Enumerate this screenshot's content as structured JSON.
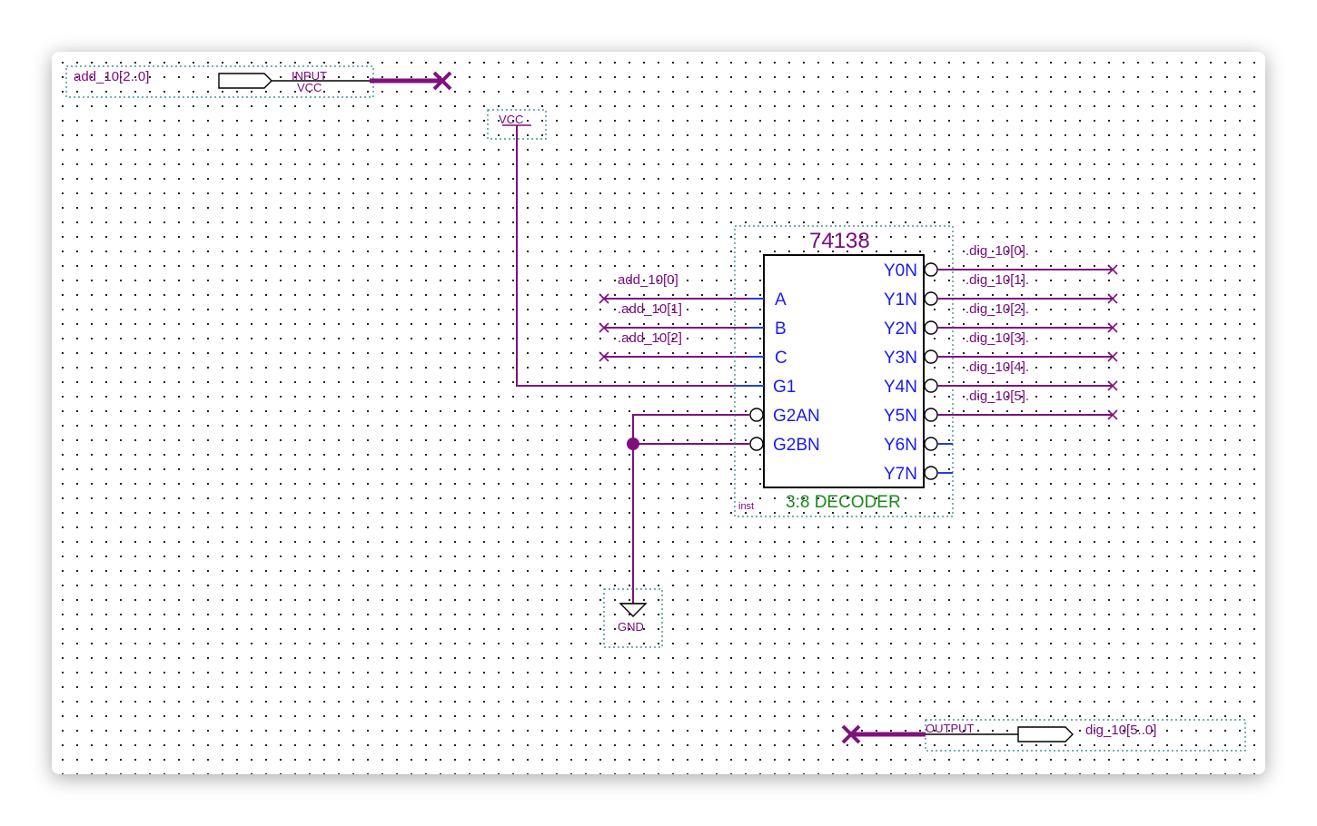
{
  "input_port": {
    "name": "add_10[2..0]",
    "type_label": "INPUT",
    "default_label": "VCC"
  },
  "output_port": {
    "name": "dig_10[5..0]",
    "type_label": "OUTPUT"
  },
  "vcc_symbol": {
    "label": "VCC"
  },
  "gnd_symbol": {
    "label": "GND"
  },
  "decoder": {
    "part_number": "74138",
    "description": "3:8 DECODER",
    "instance": "inst",
    "inputs": [
      "A",
      "B",
      "C",
      "G1",
      "G2AN",
      "G2BN"
    ],
    "outputs": [
      "Y0N",
      "Y1N",
      "Y2N",
      "Y3N",
      "Y4N",
      "Y5N",
      "Y6N",
      "Y7N"
    ]
  },
  "input_nets": [
    "add_10[0]",
    ".add_10[1]",
    ".add_10[2]"
  ],
  "output_nets": [
    ".dig_10[0].",
    ".dig_10[1].",
    ".dig_10[2].",
    ".dig_10[3].",
    ".dig_10[4].",
    ".dig_10[5]."
  ],
  "colors": {
    "wire": "#80107e",
    "pin_text": "#1a1af0",
    "description_text": "#1a8a1a",
    "grid_dot": "#000000"
  }
}
